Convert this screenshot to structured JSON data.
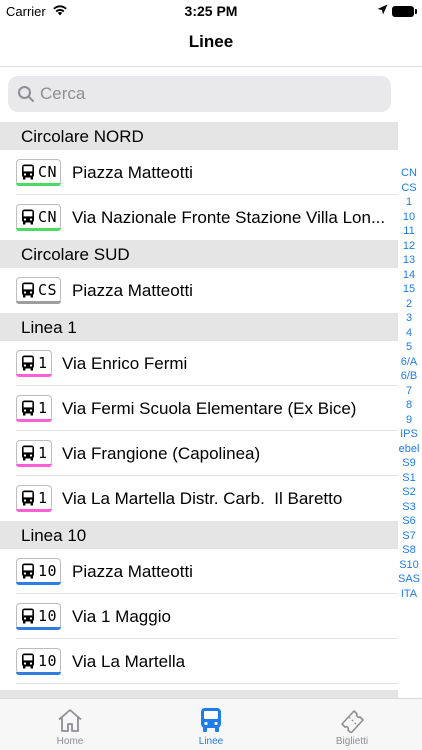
{
  "status_bar": {
    "carrier": "Carrier",
    "time": "3:25 PM"
  },
  "nav": {
    "title": "Linee"
  },
  "search": {
    "placeholder": "Cerca"
  },
  "colors": {
    "accent": "#1f7ce8",
    "cn": "#4cd964",
    "cs": "#9e9e9e",
    "linea1": "#ff5fd6",
    "linea10": "#2f7de1"
  },
  "sections": [
    {
      "title": "Circolare NORD",
      "code": "CN",
      "rows": [
        "Piazza Matteotti",
        "Via Nazionale Fronte Stazione Villa Lon..."
      ]
    },
    {
      "title": "Circolare SUD",
      "code": "CS",
      "rows": [
        "Piazza Matteotti"
      ]
    },
    {
      "title": "Linea 1",
      "code": "1",
      "rows": [
        "Via Enrico Fermi",
        "Via Fermi Scuola Elementare (Ex Bice)",
        "Via Frangione (Capolinea)",
        "Via La Martella Distr. Carb.  Il Baretto"
      ]
    },
    {
      "title": "Linea 10",
      "code": "10",
      "rows": [
        "Piazza Matteotti",
        "Via 1 Maggio",
        "Via La Martella"
      ]
    }
  ],
  "index": [
    "CN",
    "CS",
    "1",
    "10",
    "11",
    "12",
    "13",
    "14",
    "15",
    "2",
    "3",
    "4",
    "5",
    "6/A",
    "6/B",
    "7",
    "8",
    "9",
    "IPS",
    "ebel",
    "S9",
    "S1",
    "S2",
    "S3",
    "S6",
    "S7",
    "S8",
    "S10",
    "SAS",
    "ITA"
  ],
  "tabs": [
    {
      "label": "Home",
      "icon": "home-icon"
    },
    {
      "label": "Linee",
      "icon": "bus-icon"
    },
    {
      "label": "Biglietti",
      "icon": "ticket-icon"
    }
  ]
}
